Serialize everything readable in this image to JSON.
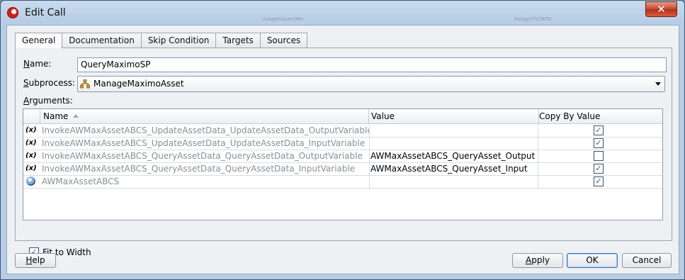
{
  "window": {
    "title": "Edit Call",
    "close_glyph": "✕"
  },
  "background": {
    "label_left": "Assign\\QueryMo",
    "label_right": "Assign\\T\\CMPO"
  },
  "tabs": [
    {
      "label": "General",
      "active": true
    },
    {
      "label": "Documentation",
      "active": false
    },
    {
      "label": "Skip Condition",
      "active": false
    },
    {
      "label": "Targets",
      "active": false
    },
    {
      "label": "Sources",
      "active": false
    }
  ],
  "form": {
    "name_label_u": "N",
    "name_label_rest": "ame:",
    "name_value": "QueryMaximoSP",
    "subprocess_label_u": "S",
    "subprocess_label_rest": "ubprocess:",
    "subprocess_value": "ManageMaximoAsset",
    "subprocess_icon": "hierarchy-icon",
    "arguments_label_u": "A",
    "arguments_label_rest": "rguments:"
  },
  "table": {
    "columns": {
      "name": "Name",
      "value": "Value",
      "copy_by_value": "Copy By Value"
    },
    "rows": [
      {
        "icon": "variable-icon",
        "icon_glyph": "(x)",
        "name": "InvokeAWMaxAssetABCS_UpdateAssetData_UpdateAssetData_OutputVariable",
        "value": "",
        "checked": true,
        "check_glyph": "✓"
      },
      {
        "icon": "variable-icon",
        "icon_glyph": "(x)",
        "name": "InvokeAWMaxAssetABCS_UpdateAssetData_UpdateAssetData_InputVariable",
        "value": "",
        "checked": true,
        "check_glyph": "✓"
      },
      {
        "icon": "variable-icon",
        "icon_glyph": "(x)",
        "name": "InvokeAWMaxAssetABCS_QueryAssetData_QueryAssetData_OutputVariable",
        "value": "AWMaxAssetABCS_QueryAsset_Output",
        "checked": false,
        "check_glyph": ""
      },
      {
        "icon": "variable-icon",
        "icon_glyph": "(x)",
        "name": "InvokeAWMaxAssetABCS_QueryAssetData_QueryAssetData_InputVariable",
        "value": "AWMaxAssetABCS_QueryAsset_Input",
        "checked": true,
        "check_glyph": "✓"
      },
      {
        "icon": "service-icon",
        "icon_glyph": "",
        "name": "AWMaxAssetABCS",
        "value": "",
        "checked": true,
        "check_glyph": "✓"
      }
    ]
  },
  "fit_to_width": {
    "checked": true,
    "check_glyph": "✓",
    "label_u": "F",
    "label_rest": "it to Width"
  },
  "buttons": {
    "help_u": "H",
    "help_rest": "elp",
    "apply_u": "A",
    "apply_rest": "pply",
    "ok": "OK",
    "cancel": "Cancel"
  }
}
